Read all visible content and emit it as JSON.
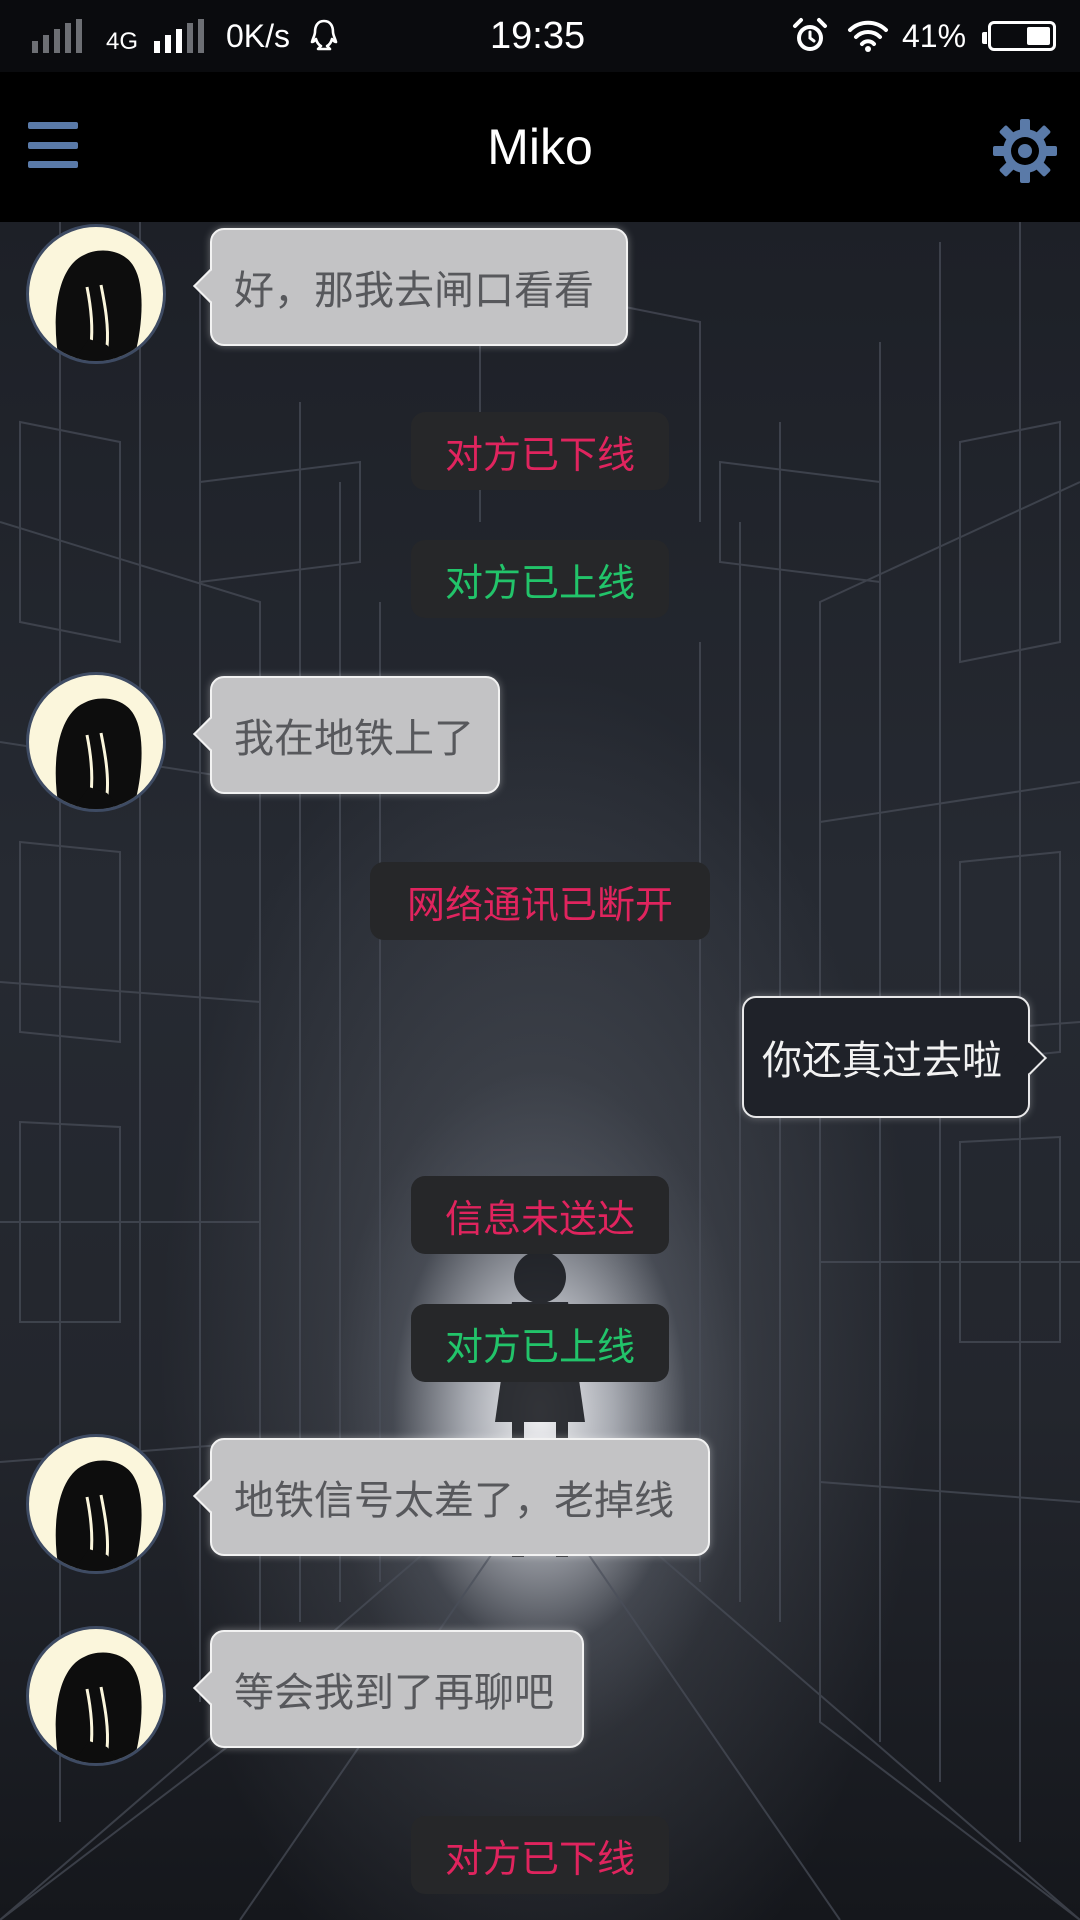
{
  "status_bar": {
    "network_type": "4G",
    "speed": "0K/s",
    "time": "19:35",
    "battery": "41%",
    "battery_level": 0.41,
    "icons": [
      "signal-icon",
      "qq-icon",
      "alarm-icon",
      "wifi-icon",
      "battery-icon"
    ]
  },
  "header": {
    "title": "Miko",
    "menu_icon": "menu-icon",
    "settings_icon": "gear-icon"
  },
  "messages": [
    {
      "type": "incoming",
      "text": "好，那我去闸口看看"
    },
    {
      "type": "status",
      "status": "offline",
      "text": "对方已下线"
    },
    {
      "type": "status",
      "status": "online",
      "text": "对方已上线"
    },
    {
      "type": "incoming",
      "text": "我在地铁上了"
    },
    {
      "type": "status",
      "status": "error",
      "text": "网络通讯已断开"
    },
    {
      "type": "outgoing",
      "text": "你还真过去啦"
    },
    {
      "type": "status",
      "status": "error",
      "text": "信息未送达"
    },
    {
      "type": "status",
      "status": "online",
      "text": "对方已上线"
    },
    {
      "type": "incoming",
      "text": "地铁信号太差了，老掉线"
    },
    {
      "type": "incoming",
      "text": "等会我到了再聊吧"
    },
    {
      "type": "status",
      "status": "offline",
      "text": "对方已下线"
    }
  ],
  "colors": {
    "status_red": "#e0245e",
    "status_green": "#22c46a",
    "incoming_bubble": "#c3c3c5",
    "outgoing_bubble": "#1f2229",
    "accent_blue": "#5a7aa8"
  }
}
